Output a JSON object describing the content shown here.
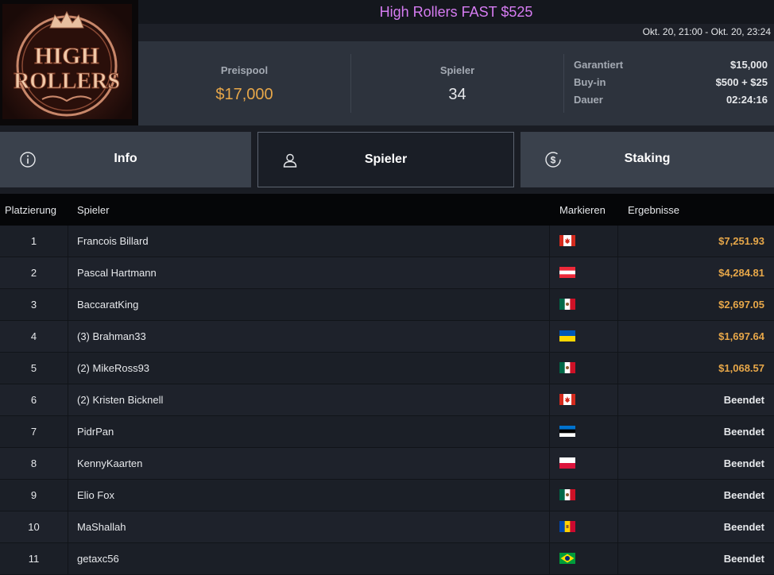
{
  "tournament": {
    "title": "High Rollers FAST $525",
    "date_range": "Okt. 20, 21:00 - Okt. 20, 23:24",
    "logo_text_1": "HIGH",
    "logo_text_2": "ROLLERS"
  },
  "stats": {
    "prizepool_label": "Preispool",
    "prizepool_value": "$17,000",
    "players_label": "Spieler",
    "players_value": "34",
    "guaranteed_label": "Garantiert",
    "guaranteed_value": "$15,000",
    "buyin_label": "Buy-in",
    "buyin_value": "$500 + $25",
    "duration_label": "Dauer",
    "duration_value": "02:24:16"
  },
  "tabs": [
    {
      "label": "Info",
      "icon": "info-icon",
      "active": false
    },
    {
      "label": "Spieler",
      "icon": "user-icon",
      "active": true
    },
    {
      "label": "Staking",
      "icon": "dollar-icon",
      "active": false
    }
  ],
  "table": {
    "headers": {
      "rank": "Platzierung",
      "player": "Spieler",
      "mark": "Markieren",
      "results": "Ergebnisse"
    },
    "rows": [
      {
        "rank": "1",
        "player": "Francois Billard",
        "flag": "canada",
        "result": "$7,251.93",
        "paid": true
      },
      {
        "rank": "2",
        "player": "Pascal Hartmann",
        "flag": "austria",
        "result": "$4,284.81",
        "paid": true
      },
      {
        "rank": "3",
        "player": "BaccaratKing",
        "flag": "mexico",
        "result": "$2,697.05",
        "paid": true
      },
      {
        "rank": "4",
        "player": "(3) Brahman33",
        "flag": "ukraine",
        "result": "$1,697.64",
        "paid": true
      },
      {
        "rank": "5",
        "player": "(2) MikeRoss93",
        "flag": "mexico",
        "result": "$1,068.57",
        "paid": true
      },
      {
        "rank": "6",
        "player": "(2) Kristen Bicknell",
        "flag": "canada",
        "result": "Beendet",
        "paid": false
      },
      {
        "rank": "7",
        "player": "PidrPan",
        "flag": "estonia",
        "result": "Beendet",
        "paid": false
      },
      {
        "rank": "8",
        "player": "KennyKaarten",
        "flag": "poland",
        "result": "Beendet",
        "paid": false
      },
      {
        "rank": "9",
        "player": "Elio Fox",
        "flag": "mexico",
        "result": "Beendet",
        "paid": false
      },
      {
        "rank": "10",
        "player": "MaShallah",
        "flag": "moldova",
        "result": "Beendet",
        "paid": false
      },
      {
        "rank": "11",
        "player": "getaxc56",
        "flag": "brazil",
        "result": "Beendet",
        "paid": false
      }
    ]
  },
  "colors": {
    "title": "#d67cf2",
    "money": "#e7a749",
    "active_tab": "#1a1e26",
    "inactive_tab": "#3a414c"
  }
}
